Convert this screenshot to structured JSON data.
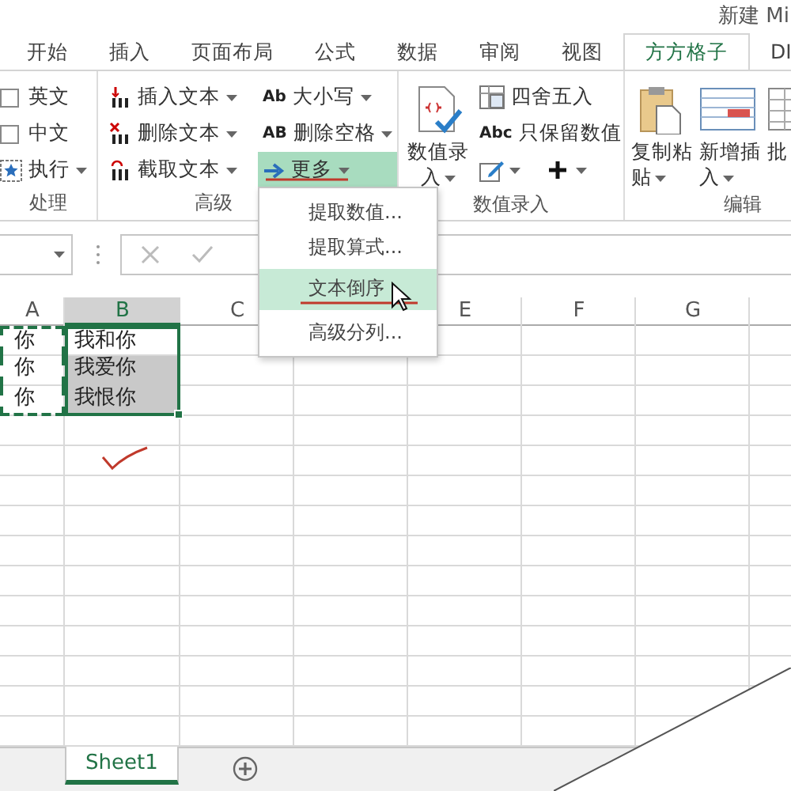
{
  "title": "新建 Mi",
  "tabs": [
    {
      "label": "开始",
      "selected": false
    },
    {
      "label": "插入",
      "selected": false
    },
    {
      "label": "页面布局",
      "selected": false
    },
    {
      "label": "公式",
      "selected": false
    },
    {
      "label": "数据",
      "selected": false
    },
    {
      "label": "审阅",
      "selected": false
    },
    {
      "label": "视图",
      "selected": false
    },
    {
      "label": "方方格子",
      "selected": true
    },
    {
      "label": "DI",
      "selected": false
    }
  ],
  "ribbon": {
    "groups": [
      {
        "kind": "checklist",
        "label": "处理",
        "items": [
          {
            "kind": "checkbox",
            "label": "英文",
            "checked": false
          },
          {
            "kind": "checkbox",
            "label": "中文",
            "checked": false
          },
          {
            "kind": "menu",
            "label": "执行"
          }
        ]
      },
      {
        "kind": "text-tools",
        "label": "高级",
        "columns": [
          [
            {
              "label": "插入文本",
              "expanded": false
            },
            {
              "label": "删除文本",
              "expanded": false
            },
            {
              "label": "截取文本",
              "expanded": false
            }
          ],
          [
            {
              "label": "大小写",
              "icon_text": "Ab",
              "expanded": false
            },
            {
              "label": "删除空格",
              "icon_text": "AB",
              "expanded": false
            },
            {
              "label": "更多",
              "expanded": true
            }
          ]
        ]
      },
      {
        "kind": "number-entry",
        "label": "数值录入",
        "big_button": {
          "label": "数值录入"
        },
        "items": [
          {
            "label": "四舍五入"
          },
          {
            "label": "只保留数值",
            "icon_text": "Abc"
          }
        ]
      },
      {
        "kind": "edit",
        "label": "编辑",
        "buttons": [
          {
            "label": "复制粘贴",
            "dropdown": true
          },
          {
            "label": "新增插入",
            "dropdown": true
          },
          {
            "label": "批"
          }
        ]
      }
    ]
  },
  "menu": {
    "items": [
      {
        "label": "提取数值...",
        "selected": false
      },
      {
        "label": "提取算式...",
        "selected": false
      },
      {
        "label": "文本倒序",
        "selected": true
      },
      {
        "label": "高级分列...",
        "selected": false
      }
    ]
  },
  "sheet": {
    "columns": [
      {
        "label": "A",
        "selected": false
      },
      {
        "label": "B",
        "selected": true
      },
      {
        "label": "C",
        "selected": false
      },
      {
        "label": "E",
        "selected": false
      },
      {
        "label": "F",
        "selected": false
      },
      {
        "label": "G",
        "selected": false
      }
    ],
    "rows": [
      {
        "cells": [
          {
            "text": "你",
            "copied": true
          },
          {
            "text": "我和你",
            "selected": true,
            "active": true
          }
        ]
      },
      {
        "cells": [
          {
            "text": "你",
            "copied": true
          },
          {
            "text": "我爱你",
            "selected": true,
            "active": false
          }
        ]
      },
      {
        "cells": [
          {
            "text": "你",
            "copied": true
          },
          {
            "text": "我恨你",
            "selected": true,
            "active": false
          }
        ]
      }
    ]
  },
  "sheet_tabs": [
    {
      "label": "Sheet1",
      "selected": true
    }
  ]
}
